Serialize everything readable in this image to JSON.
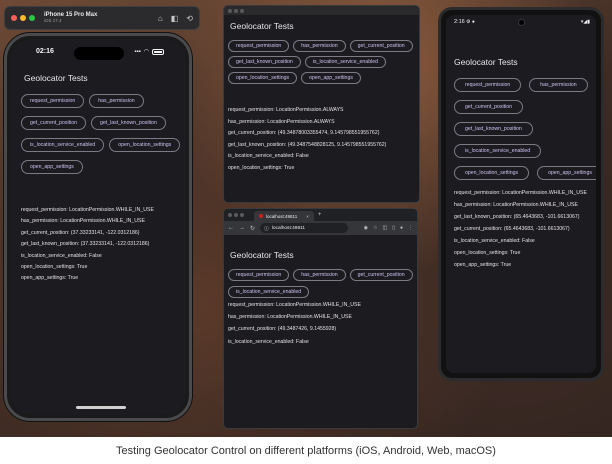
{
  "caption": "Testing Geolocator Control on different platforms (iOS, Android, Web, macOS)",
  "colors": {
    "background_screen": "#1c1b1f",
    "button_text": "#cfc2f3",
    "button_border": "#7d7a84",
    "result_text": "#e6e1e8"
  },
  "ios": {
    "simulator_title": "iPhone 15 Pro Max",
    "simulator_subtitle": "iOS 17.4",
    "simulator_icons": [
      "home-icon",
      "screenshot-icon",
      "rotate-icon"
    ],
    "time": "02:16",
    "app_title": "Geolocator Tests",
    "buttons": [
      "request_permission",
      "has_permission",
      "get_current_position",
      "get_last_known_position",
      "is_location_service_enabled",
      "open_location_settings",
      "open_app_settings"
    ],
    "results": [
      "request_permission: LocationPermission.WHILE_IN_USE",
      "has_permission: LocationPermission.WHILE_IN_USE",
      "get_current_position: (37.33233141, -122.0312186)",
      "get_last_known_position: (37.33233141, -122.0312186)",
      "is_location_service_enabled: False",
      "open_location_settings: True",
      "open_app_settings: True"
    ]
  },
  "macos": {
    "app_title": "Geolocator Tests",
    "buttons": [
      "request_permission",
      "has_permission",
      "get_current_position",
      "get_last_known_position",
      "is_location_service_enabled",
      "open_location_settings",
      "open_app_settings"
    ],
    "results": [
      "request_permission: LocationPermission.ALWAYS",
      "has_permission: LocationPermission.ALWAYS",
      "get_current_position: (49.34878003355474, 9.145798551955762)",
      "get_last_known_position: (49.3487548828125, 9.145798551955762)",
      "is_location_service_enabled: False",
      "open_location_settings: True"
    ]
  },
  "web": {
    "tab_title": "localhost:49811",
    "tab_close": "×",
    "new_tab": "+",
    "url": "localhost:49811",
    "app_title": "Geolocator Tests",
    "buttons": [
      "request_permission",
      "has_permission",
      "get_current_position",
      "is_location_service_enabled"
    ],
    "results": [
      "request_permission: LocationPermission.WHILE_IN_USE",
      "has_permission: LocationPermission.WHILE_IN_USE",
      "get_current_position: (49.3487426, 9.1455928)",
      "is_location_service_enabled: False"
    ]
  },
  "android": {
    "time": "2:16",
    "app_title": "Geolocator Tests",
    "buttons": [
      "request_permission",
      "has_permission",
      "get_current_position",
      "get_last_known_position",
      "is_location_service_enabled",
      "open_location_settings",
      "open_app_settings"
    ],
    "results": [
      "request_permission: LocationPermission.WHILE_IN_USE",
      "has_permission: LocationPermission.WHILE_IN_USE",
      "get_last_known_position: (65.4643683, -101.6613067)",
      "get_current_position: (65.4643683, -101.6613067)",
      "is_location_service_enabled: False",
      "open_location_settings: True",
      "open_app_settings: True"
    ]
  }
}
